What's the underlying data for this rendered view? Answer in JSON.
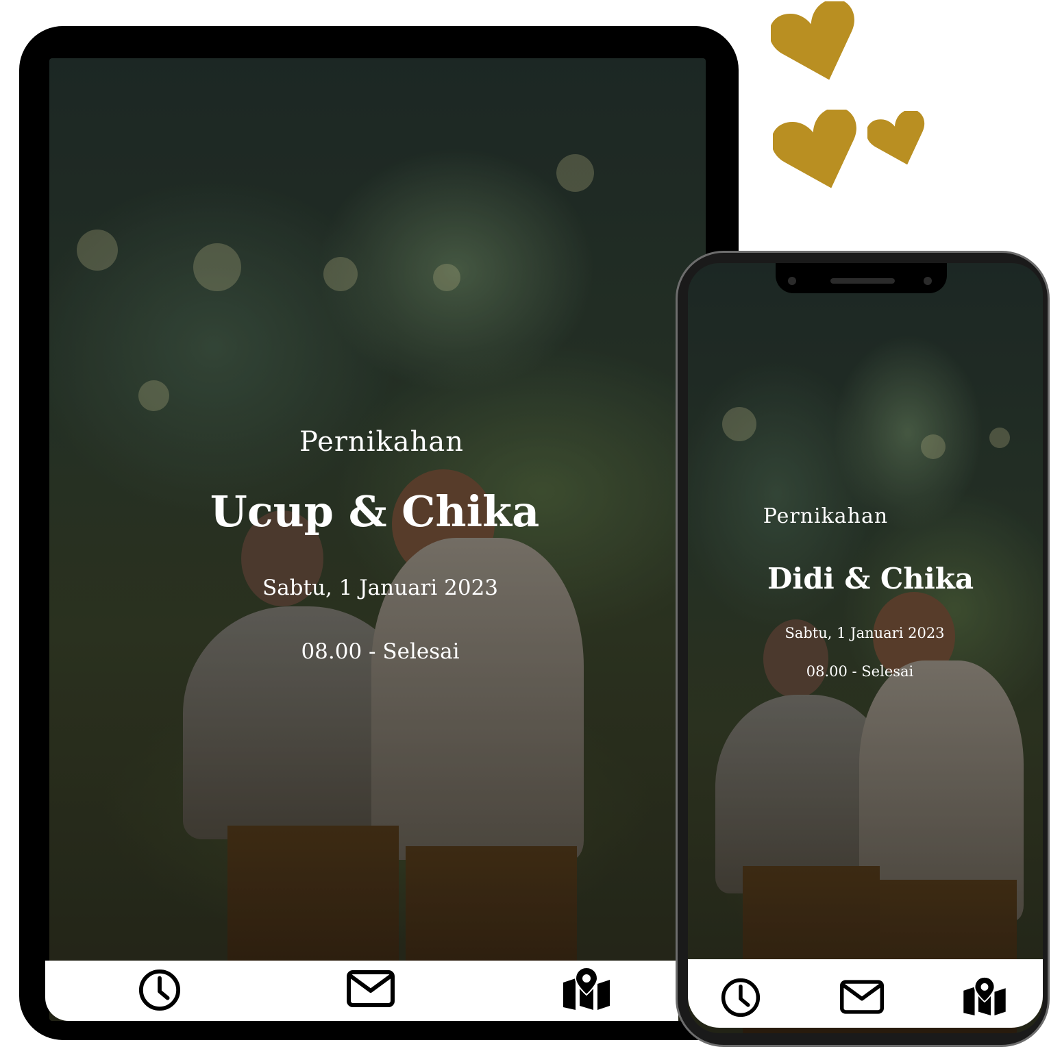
{
  "colors": {
    "accent_gold": "#b98f22",
    "device_frame": "#000000",
    "nav_background": "#ffffff",
    "text": "#ffffff"
  },
  "tablet": {
    "title": "Pernikahan",
    "names": "Ucup & Chika",
    "date": "Sabtu, 1 Januari 2023",
    "time": "08.00 - Selesai",
    "nav": [
      "clock-icon",
      "envelope-icon",
      "map-pin-icon"
    ]
  },
  "phone": {
    "title": "Pernikahan",
    "names": "Didi & Chika",
    "date": "Sabtu, 1 Januari 2023",
    "time": "08.00 - Selesai",
    "nav": [
      "clock-icon",
      "envelope-icon",
      "map-pin-icon"
    ]
  },
  "decorations": [
    "heart-icon",
    "heart-icon",
    "heart-icon"
  ]
}
